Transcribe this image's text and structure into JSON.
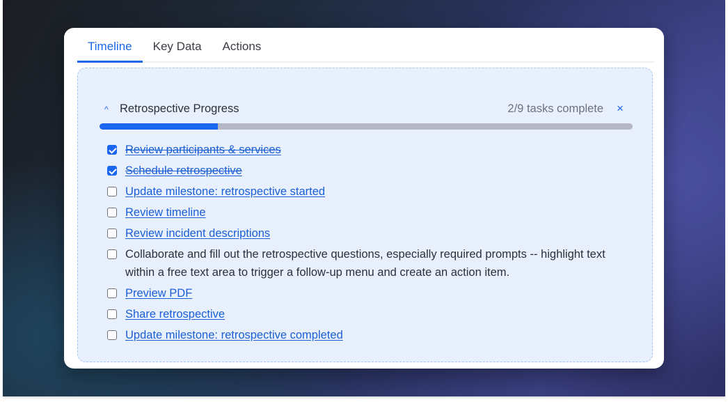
{
  "tabs": [
    {
      "label": "Timeline",
      "active": true
    },
    {
      "label": "Key Data",
      "active": false
    },
    {
      "label": "Actions",
      "active": false
    }
  ],
  "progress_panel": {
    "title": "Retrospective Progress",
    "toggle_icon": "chevron-up-icon",
    "toggle_glyph": "^",
    "status": "2/9 tasks complete",
    "close_icon": "close-icon",
    "close_glyph": "×",
    "completed": 2,
    "total": 9,
    "progress_fraction": 0.222,
    "colors": {
      "accent": "#1a66f0",
      "track": "#b5b7c6",
      "panel_bg": "#e8f0fd",
      "link": "#1a5fd6"
    }
  },
  "tasks": [
    {
      "label": "Review participants & services",
      "checked": true,
      "link": true
    },
    {
      "label": "Schedule retrospective",
      "checked": true,
      "link": true
    },
    {
      "label": "Update milestone: retrospective started",
      "checked": false,
      "link": true
    },
    {
      "label": "Review timeline",
      "checked": false,
      "link": true
    },
    {
      "label": "Review incident descriptions",
      "checked": false,
      "link": true
    },
    {
      "label": "Collaborate and fill out the retrospective questions, especially required prompts -- highlight text within a free text area to trigger a follow-up menu and create an action item.",
      "checked": false,
      "link": false
    },
    {
      "label": "Preview PDF",
      "checked": false,
      "link": true
    },
    {
      "label": "Share retrospective",
      "checked": false,
      "link": true
    },
    {
      "label": "Update milestone: retrospective completed",
      "checked": false,
      "link": true
    }
  ]
}
